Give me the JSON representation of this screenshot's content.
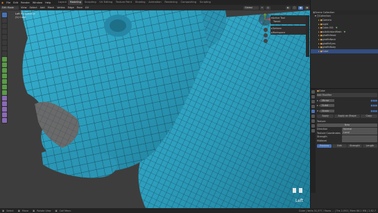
{
  "topbar": {
    "menus": [
      "File",
      "Edit",
      "Render",
      "Window",
      "Help"
    ],
    "workspace_tabs": [
      "Layout",
      "Modeling",
      "Sculpting",
      "UV Editing",
      "Texture Paint",
      "Shading",
      "Animation",
      "Rendering",
      "Compositing",
      "Scripting"
    ],
    "active_tab_index": 1,
    "scene": "Scene",
    "view_layer": "View Layer"
  },
  "header": {
    "mode": "Edit Mode",
    "menus": [
      "View",
      "Select",
      "Add",
      "Mesh",
      "Vertex",
      "Edge",
      "Face",
      "UV"
    ],
    "orientation": "Global",
    "view_label": "Left"
  },
  "viewport_info": {
    "line1": "Left Perspective",
    "line2": "(1) Cube"
  },
  "overlay_panel": {
    "title": "Active Tool",
    "tool": "Tweak",
    "sections": [
      "Options",
      "Workspace"
    ]
  },
  "outliner": {
    "title": "Scene Collection",
    "items": [
      {
        "label": "Collection",
        "indent": 1
      },
      {
        "label": "Camera",
        "indent": 2
      },
      {
        "label": "Light",
        "indent": 2
      },
      {
        "label": "Cube.001",
        "indent": 2
      },
      {
        "label": "subdivisionMesh",
        "indent": 2
      },
      {
        "label": "giraffeHead",
        "indent": 2
      },
      {
        "label": "giraffeNeck",
        "indent": 2
      },
      {
        "label": "giraffeEyes",
        "indent": 2
      },
      {
        "label": "giraffeBody",
        "indent": 2
      },
      {
        "label": "Cube",
        "indent": 2,
        "selected": true
      }
    ]
  },
  "properties": {
    "object": "Cube",
    "section": "Add Modifier",
    "modifiers": [
      {
        "name": "Mirror"
      },
      {
        "name": "Subd"
      },
      {
        "name": "Shrnk"
      }
    ],
    "buttons": [
      "Apply",
      "Apply as Shape",
      "Copy"
    ],
    "texture_label": "Texture",
    "new_label": "New",
    "direction_label": "Direction",
    "direction_value": "Normal",
    "coords_label": "Texture Coordinates",
    "coords_value": "Local",
    "strength_label": "Strength",
    "midlevel_label": "Midlevel",
    "tabs": [
      "Preview",
      "Edit",
      "Strength",
      "Length"
    ]
  },
  "status": {
    "left": [
      "Select",
      "Move",
      "Rotate View",
      "Call Menu"
    ],
    "right": "Cube | Verts 31,577 / Faces ... | Tris 2,053 | Mem 86.1 MB | 2.82.7"
  },
  "colors": {
    "mesh": "#2f9fbe",
    "accent": "#4a72b5",
    "panel": "#2b2b2b"
  }
}
